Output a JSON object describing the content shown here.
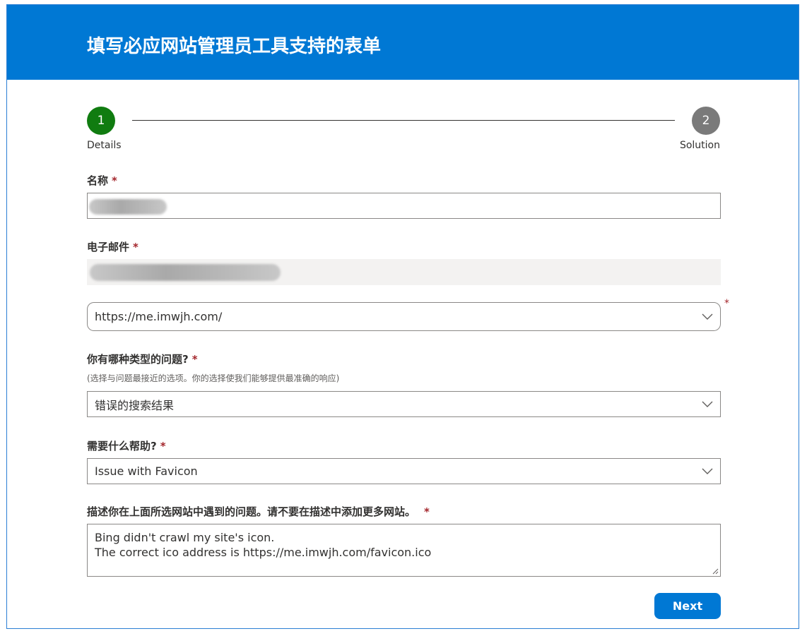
{
  "header": {
    "title": "填写必应网站管理员工具支持的表单"
  },
  "stepper": {
    "steps": [
      {
        "number": "1",
        "label": "Details",
        "state": "active",
        "color": "#107c10"
      },
      {
        "number": "2",
        "label": "Solution",
        "state": "pending",
        "color": "#7a7a7a"
      }
    ]
  },
  "form": {
    "name": {
      "label": "名称",
      "required_mark": "*",
      "value": ""
    },
    "email": {
      "label": "电子邮件",
      "required_mark": "*",
      "value": ""
    },
    "site": {
      "selected": "https://me.imwjh.com/",
      "required_mark": "*"
    },
    "issue_type": {
      "label": "你有哪种类型的问题?",
      "required_mark": "*",
      "hint": "(选择与问题最接近的选项。你的选择使我们能够提供最准确的响应)",
      "selected": "错误的搜索结果"
    },
    "help": {
      "label": "需要什么帮助?",
      "required_mark": "*",
      "selected": "Issue with Favicon"
    },
    "description": {
      "label": "描述你在上面所选网站中遇到的问题。请不要在描述中添加更多网站。",
      "required_mark": "*",
      "lines": [
        "Bing didn't crawl my site's icon.",
        "The correct ico address is https://me.imwjh.com/favicon.ico"
      ]
    }
  },
  "actions": {
    "next_label": "Next"
  },
  "colors": {
    "brand": "#0078d4",
    "active_step": "#107c10",
    "pending_step": "#7a7a7a",
    "required": "#a4262c"
  }
}
